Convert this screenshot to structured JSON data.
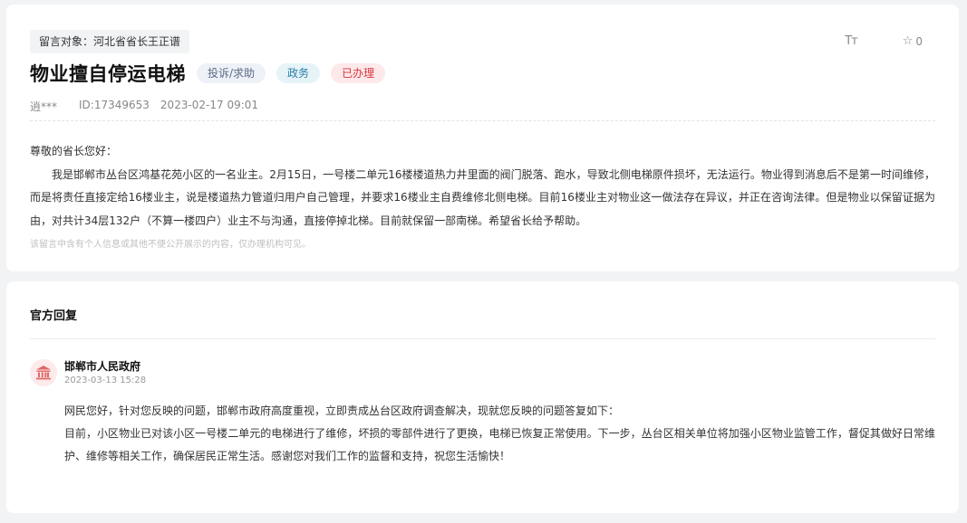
{
  "message": {
    "target_label": "留言对象：河北省省长王正谱",
    "title": "物业擅自停运电梯",
    "tags": {
      "type": "投诉/求助",
      "domain": "政务",
      "status": "已办理"
    },
    "font_tool_label": "Tт",
    "favorite_count": "0",
    "author": "逍***",
    "id_label": "ID:17349653",
    "datetime": "2023-02-17 09:01",
    "greeting": "尊敬的省长您好：",
    "body": "我是邯郸市丛台区鸿基花苑小区的一名业主。2月15日，一号楼二单元16楼楼道热力井里面的阀门脱落、跑水，导致北侧电梯原件损坏，无法运行。物业得到消息后不是第一时间维修，而是将责任直接定给16楼业主，说是楼道热力管道归用户自己管理，并要求16楼业主自费维修北侧电梯。目前16楼业主对物业这一做法存在异议，并正在咨询法律。但是物业以保留证据为由，对共计34层132户（不算一楼四户）业主不与沟通，直接停掉北梯。目前就保留一部南梯。希望省长给予帮助。",
    "privacy_note": "该留言中含有个人信息或其他不便公开展示的内容，仅办理机构可见。"
  },
  "reply": {
    "section_title": "官方回复",
    "org_name": "邯郸市人民政府",
    "org_icon": "government-building-icon",
    "datetime": "2023-03-13 15:28",
    "line1": "网民您好，针对您反映的问题，邯郸市政府高度重视，立即责成丛台区政府调查解决，现就您反映的问题答复如下：",
    "line2": "目前，小区物业已对该小区一号楼二单元的电梯进行了维修，坏损的零部件进行了更换，电梯已恢复正常使用。下一步，丛台区相关单位将加强小区物业监管工作，督促其做好日常维护、维修等相关工作，确保居民正常生活。感谢您对我们工作的监督和支持，祝您生活愉快！"
  },
  "colors": {
    "status_red": "#d9363e",
    "domain_blue": "#2a7fa8",
    "type_gray": "#5a6b88",
    "icon_red": "#e06666"
  }
}
